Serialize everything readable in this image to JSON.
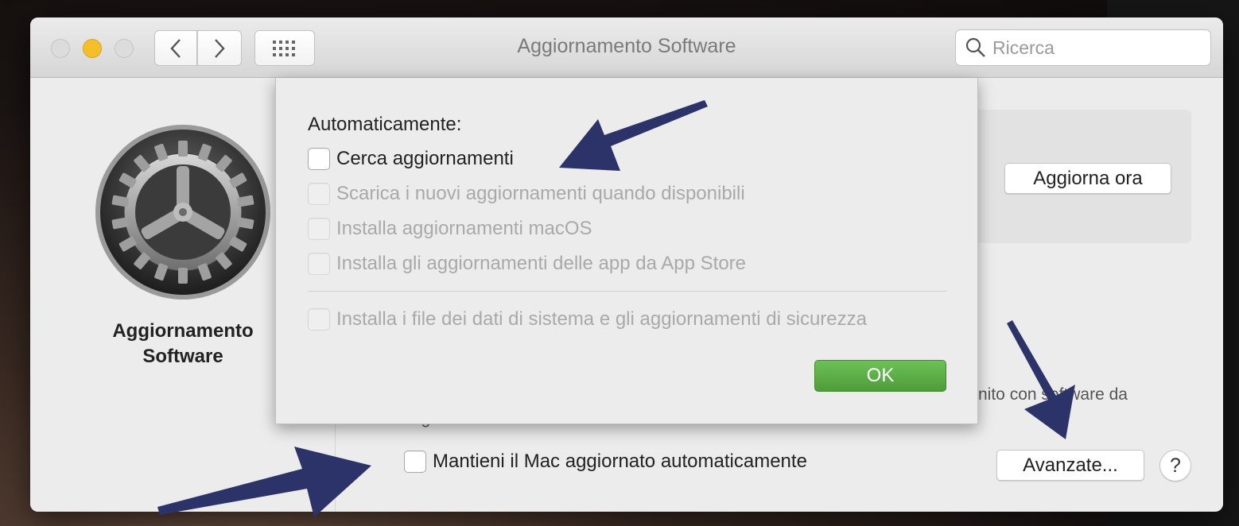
{
  "window": {
    "title": "Aggiornamento Software",
    "search_placeholder": "Ricerca"
  },
  "sidebar": {
    "app_name_line1": "Aggiornamento",
    "app_name_line2": "Software"
  },
  "main": {
    "update_now_label": "Aggiorna ora",
    "info_fragment": "nito con software da",
    "info_fragment2": "ag",
    "auto_update_label": "Mantieni il Mac aggiornato automaticamente",
    "advanced_label": "Avanzate...",
    "help_label": "?"
  },
  "sheet": {
    "title": "Automaticamente:",
    "options": [
      {
        "label": "Cerca aggiornamenti",
        "checked": false,
        "enabled": true
      },
      {
        "label": "Scarica i nuovi aggiornamenti quando disponibili",
        "checked": false,
        "enabled": false
      },
      {
        "label": "Installa aggiornamenti macOS",
        "checked": false,
        "enabled": false
      },
      {
        "label": "Installa gli aggiornamenti delle app da App Store",
        "checked": false,
        "enabled": false
      },
      {
        "label": "Installa i file dei dati di sistema e gli aggiornamenti di sicurezza",
        "checked": false,
        "enabled": false
      }
    ],
    "ok_label": "OK"
  },
  "colors": {
    "ok_button": "#5aab45",
    "arrow": "#2b3368",
    "minimize_light": "#f5bf2a"
  },
  "icons": [
    "back-chevron-icon",
    "forward-chevron-icon",
    "grid-icon",
    "search-icon",
    "software-update-gear-icon"
  ]
}
